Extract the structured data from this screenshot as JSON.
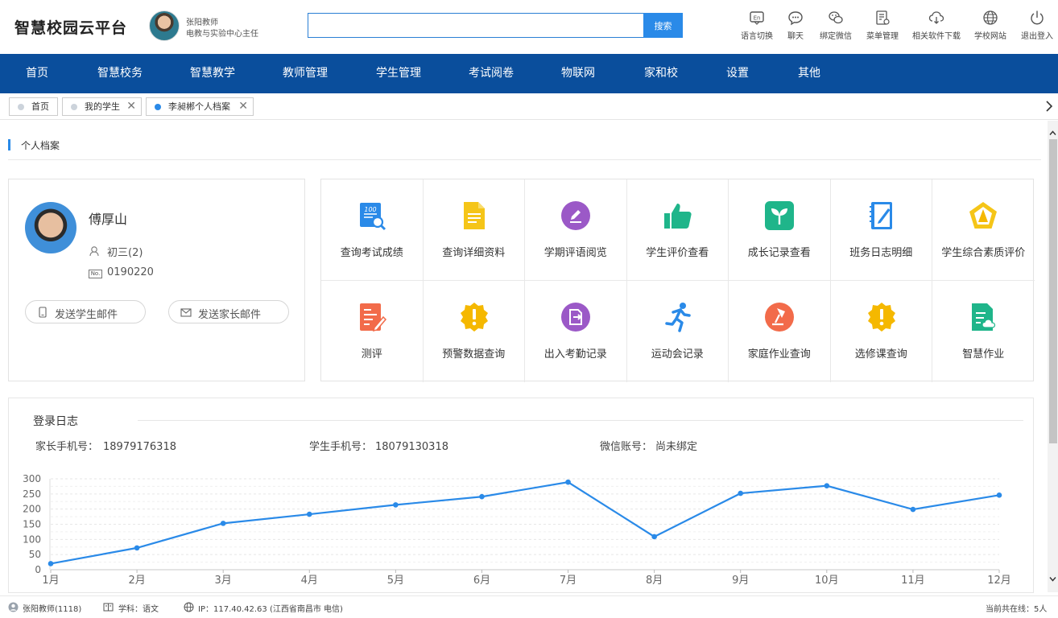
{
  "header": {
    "brand": "智慧校园云平台",
    "user_name": "张阳教师",
    "user_role": "电教与实验中心主任",
    "search_placeholder": "",
    "search_label": "搜索",
    "tools": [
      {
        "label": "语言切换",
        "icon": "language-icon"
      },
      {
        "label": "聊天",
        "icon": "chat-icon"
      },
      {
        "label": "绑定微信",
        "icon": "wechat-icon"
      },
      {
        "label": "菜单管理",
        "icon": "menu-manage-icon"
      },
      {
        "label": "相关软件下载",
        "icon": "cloud-download-icon"
      },
      {
        "label": "学校网站",
        "icon": "globe-icon"
      },
      {
        "label": "退出登入",
        "icon": "power-icon"
      }
    ]
  },
  "nav": [
    "首页",
    "智慧校务",
    "智慧教学",
    "教师管理",
    "学生管理",
    "考试阅卷",
    "物联网",
    "家和校",
    "设置",
    "其他"
  ],
  "tabs": [
    {
      "label": "首页",
      "closable": false,
      "active": false
    },
    {
      "label": "我的学生",
      "closable": true,
      "active": false
    },
    {
      "label": "李昶郴个人档案",
      "closable": true,
      "active": true
    }
  ],
  "section_title": "个人档案",
  "student": {
    "name": "傅厚山",
    "class": "初三(2)",
    "number": "0190220",
    "no_badge": "No.",
    "send_student_mail": "发送学生邮件",
    "send_parent_mail": "发送家长邮件"
  },
  "functions": [
    {
      "label": "查询考试成绩",
      "icon": "exam-score-icon",
      "color": "#2a8ae8"
    },
    {
      "label": "查询详细资料",
      "icon": "document-icon",
      "color": "#f5c518"
    },
    {
      "label": "学期评语阅览",
      "icon": "edit-circle-icon",
      "color": "#9b59c7"
    },
    {
      "label": "学生评价查看",
      "icon": "thumbs-up-icon",
      "color": "#1fb58a"
    },
    {
      "label": "成长记录查看",
      "icon": "sprout-icon",
      "color": "#1fb58a"
    },
    {
      "label": "班务日志明细",
      "icon": "notebook-icon",
      "color": "#2a8ae8"
    },
    {
      "label": "学生综合素质评价",
      "icon": "pentagon-badge-icon",
      "color": "#f5c518"
    },
    {
      "label": "测评",
      "icon": "test-paper-icon",
      "color": "#f26b4a"
    },
    {
      "label": "预警数据查询",
      "icon": "warning-badge-icon",
      "color": "#f5b800"
    },
    {
      "label": "出入考勤记录",
      "icon": "attendance-icon",
      "color": "#9b59c7"
    },
    {
      "label": "运动会记录",
      "icon": "runner-icon",
      "color": "#2a8ae8"
    },
    {
      "label": "家庭作业查询",
      "icon": "desk-lamp-icon",
      "color": "#f26b4a"
    },
    {
      "label": "选修课查询",
      "icon": "warning-badge-icon",
      "color": "#f5b800"
    },
    {
      "label": "智慧作业",
      "icon": "cloud-doc-icon",
      "color": "#1fb58a"
    }
  ],
  "log": {
    "title": "登录日志",
    "parent_phone_label": "家长手机号：",
    "parent_phone": "18979176318",
    "student_phone_label": "学生手机号：",
    "student_phone": "18079130318",
    "wechat_label": "微信账号：",
    "wechat": "尚未绑定"
  },
  "chart_data": {
    "type": "line",
    "categories": [
      "1月",
      "2月",
      "3月",
      "4月",
      "5月",
      "6月",
      "7月",
      "8月",
      "9月",
      "10月",
      "11月",
      "12月"
    ],
    "values": [
      20,
      72,
      153,
      183,
      214,
      241,
      289,
      109,
      252,
      277,
      199,
      246
    ],
    "yticks": [
      0,
      50,
      100,
      150,
      200,
      250,
      300
    ],
    "ylim": [
      0,
      300
    ],
    "color": "#2a8ae8",
    "grid": true
  },
  "footer": {
    "user": "张阳教师(1118)",
    "subject": "学科：语文",
    "ip": "IP：117.40.42.63 (江西省南昌市 电信)",
    "online": "当前共在线：5人"
  }
}
